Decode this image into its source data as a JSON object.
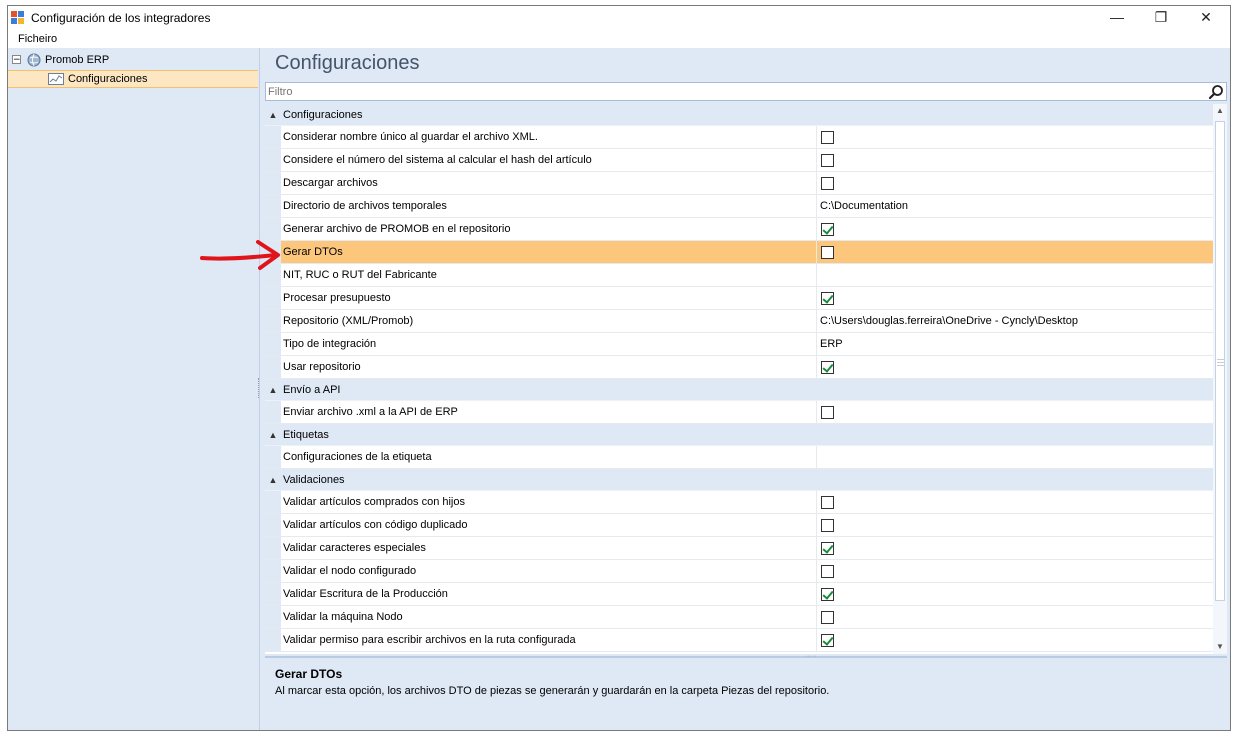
{
  "window": {
    "title": "Configuración de los integradores",
    "controls": {
      "minimize": "—",
      "restore": "❐",
      "close": "✕"
    }
  },
  "menu": {
    "items": [
      "Ficheiro"
    ]
  },
  "tree": {
    "root": {
      "label": "Promob ERP",
      "expander": "⊟"
    },
    "child": {
      "label": "Configuraciones"
    }
  },
  "main": {
    "title": "Configuraciones",
    "filter_placeholder": "Filtro"
  },
  "grid": {
    "categories": [
      {
        "label": "Configuraciones",
        "rows": [
          {
            "name": "Considerar nombre único al guardar el archivo XML.",
            "type": "checkbox",
            "checked": false
          },
          {
            "name": "Considere el número del sistema al calcular el hash del artículo",
            "type": "checkbox",
            "checked": false
          },
          {
            "name": "Descargar archivos",
            "type": "checkbox",
            "checked": false
          },
          {
            "name": "Directorio de archivos temporales",
            "type": "text",
            "value": "C:\\Documentation"
          },
          {
            "name": "Generar archivo de PROMOB en el repositorio",
            "type": "checkbox",
            "checked": true
          },
          {
            "name": "Gerar DTOs",
            "type": "checkbox",
            "checked": false,
            "selected": true
          },
          {
            "name": "NIT, RUC o RUT del Fabricante",
            "type": "text",
            "value": ""
          },
          {
            "name": "Procesar presupuesto",
            "type": "checkbox",
            "checked": true
          },
          {
            "name": "Repositorio (XML/Promob)",
            "type": "text",
            "value": "C:\\Users\\douglas.ferreira\\OneDrive - Cyncly\\Desktop"
          },
          {
            "name": "Tipo de integración",
            "type": "text",
            "value": "ERP"
          },
          {
            "name": "Usar repositorio",
            "type": "checkbox",
            "checked": true
          }
        ]
      },
      {
        "label": "Envío a API",
        "rows": [
          {
            "name": "Enviar archivo .xml a la API de ERP",
            "type": "checkbox",
            "checked": false
          }
        ]
      },
      {
        "label": "Etiquetas",
        "rows": [
          {
            "name": "Configuraciones de la etiqueta",
            "type": "text",
            "value": ""
          }
        ]
      },
      {
        "label": "Validaciones",
        "rows": [
          {
            "name": "Validar artículos comprados con hijos",
            "type": "checkbox",
            "checked": false
          },
          {
            "name": "Validar artículos con código duplicado",
            "type": "checkbox",
            "checked": false
          },
          {
            "name": "Validar caracteres especiales",
            "type": "checkbox",
            "checked": true
          },
          {
            "name": "Validar el nodo configurado",
            "type": "checkbox",
            "checked": false
          },
          {
            "name": "Validar Escritura de la Producción",
            "type": "checkbox",
            "checked": true
          },
          {
            "name": "Validar la máquina Nodo",
            "type": "checkbox",
            "checked": false
          },
          {
            "name": "Validar permiso para escribir archivos en la ruta configurada",
            "type": "checkbox",
            "checked": true
          }
        ]
      }
    ]
  },
  "description": {
    "title": "Gerar DTOs",
    "text": "Al marcar esta opción, los archivos DTO de piezas se generarán y guardarán en la carpeta Piezas del repositorio."
  },
  "colors": {
    "panel_bg": "#dfe9f5",
    "selected_row": "#fcc67d",
    "title_text": "#44546a",
    "annotation_arrow": "#e0141b"
  },
  "icons": {
    "filter": "search-icon",
    "app": "app-icon",
    "tree_root": "globe-icon",
    "tree_child": "chart-icon",
    "category_toggle": "collapse-icon",
    "annotation": "red-arrow-icon"
  }
}
